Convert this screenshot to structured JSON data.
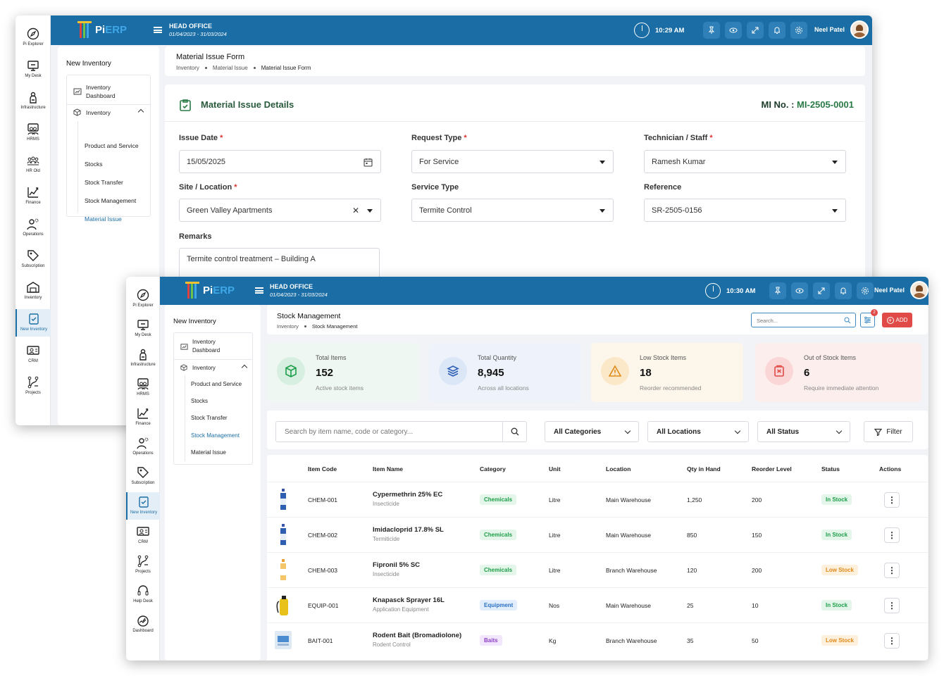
{
  "colors": {
    "brand": "#1b6ea5",
    "accent_green": "#2a7a46",
    "danger": "#e04b47",
    "success": "#1e9e4a",
    "warning": "#e08a1a"
  },
  "window1": {
    "rail": [
      {
        "label": "Pi Explorer",
        "icon": "compass-icon"
      },
      {
        "label": "My Desk",
        "icon": "desk-icon"
      },
      {
        "label": "Infrastructure",
        "icon": "building-icon"
      },
      {
        "label": "HRMS",
        "icon": "people-icon"
      },
      {
        "label": "HR Old",
        "icon": "team-icon"
      },
      {
        "label": "Finance",
        "icon": "chart-icon"
      },
      {
        "label": "Operations",
        "icon": "gear-person-icon"
      },
      {
        "label": "Subscription",
        "icon": "tag-icon"
      },
      {
        "label": "Inventory",
        "icon": "warehouse-icon"
      },
      {
        "label": "New Inventory",
        "icon": "clipboard-icon"
      },
      {
        "label": "CRM",
        "icon": "crm-icon"
      },
      {
        "label": "Projects",
        "icon": "projects-icon"
      }
    ],
    "topbar": {
      "logo_pi": "Pi",
      "logo_erp": "ERP",
      "office": "HEAD OFFICE",
      "fy": "01/04/2023 - 31/03/2024",
      "time": "10:29 AM",
      "user": "Neel Patel"
    },
    "subnav": {
      "heading": "New Inventory",
      "dashboard": "Inventory Dashboard",
      "group": "Inventory",
      "items": [
        "Product and Service",
        "Stocks",
        "Stock Transfer",
        "Stock Management",
        "Material Issue"
      ]
    },
    "page": {
      "title": "Material Issue Form",
      "crumbs": [
        "Inventory",
        "Material Issue",
        "Material Issue Form"
      ]
    },
    "form": {
      "heading": "Material Issue Details",
      "mi_label": "MI No. :",
      "mi_value": "MI-2505-0001",
      "issue_date_label": "Issue Date",
      "issue_date": "15/05/2025",
      "request_type_label": "Request Type",
      "request_type": "For Service",
      "technician_label": "Technician / Staff",
      "technician": "Ramesh Kumar",
      "site_label": "Site / Location",
      "site": "Green Valley Apartments",
      "service_type_label": "Service Type",
      "service_type": "Termite Control",
      "reference_label": "Reference",
      "reference": "SR-2505-0156",
      "remarks_label": "Remarks",
      "remarks": "Termite control treatment – Building A",
      "required_mark": "*"
    }
  },
  "window2": {
    "rail": [
      {
        "label": "Pi Explorer",
        "icon": "compass-icon"
      },
      {
        "label": "My Desk",
        "icon": "desk-icon"
      },
      {
        "label": "Infrastructure",
        "icon": "building-icon"
      },
      {
        "label": "HRMS",
        "icon": "people-icon"
      },
      {
        "label": "Finance",
        "icon": "chart-icon"
      },
      {
        "label": "Operations",
        "icon": "gear-person-icon"
      },
      {
        "label": "Subscription",
        "icon": "tag-icon"
      },
      {
        "label": "New Inventory",
        "icon": "clipboard-icon"
      },
      {
        "label": "CRM",
        "icon": "crm-icon"
      },
      {
        "label": "Projects",
        "icon": "projects-icon"
      },
      {
        "label": "Help Desk",
        "icon": "headset-icon"
      },
      {
        "label": "Dashboard",
        "icon": "dashboard-icon"
      }
    ],
    "topbar": {
      "logo_pi": "Pi",
      "logo_erp": "ERP",
      "office": "HEAD OFFICE",
      "fy": "01/04/2023 - 31/03/2024",
      "time": "10:30 AM",
      "user": "Neel Patel"
    },
    "subnav": {
      "heading": "New Inventory",
      "dashboard": "Inventory Dashboard",
      "group": "Inventory",
      "items": [
        "Product and Service",
        "Stocks",
        "Stock Transfer",
        "Stock Management",
        "Material Issue"
      ]
    },
    "page": {
      "title": "Stock Management",
      "crumbs": [
        "Inventory",
        "Stock Management"
      ],
      "search_placeholder": "Search...",
      "filter_badge": "2",
      "add_label": "ADD"
    },
    "stats": [
      {
        "label": "Total Items",
        "value": "152",
        "sub": "Active stock items"
      },
      {
        "label": "Total Quantity",
        "value": "8,945",
        "sub": "Across all locations"
      },
      {
        "label": "Low Stock Items",
        "value": "18",
        "sub": "Reorder recommended"
      },
      {
        "label": "Out of Stock Items",
        "value": "6",
        "sub": "Require immediate attention"
      }
    ],
    "filters": {
      "search_placeholder": "Search by item name, code or category...",
      "category": "All Categories",
      "location": "All Locations",
      "status": "All Status",
      "filter_label": "Filter"
    },
    "table": {
      "columns": [
        "Item Code",
        "Item Name",
        "Category",
        "Unit",
        "Location",
        "Qty in Hand",
        "Reorder Level",
        "Status",
        "Actions"
      ],
      "rows": [
        {
          "code": "CHEM-001",
          "name": "Cypermethrin 25% EC",
          "type": "Insecticide",
          "category": "Chemicals",
          "unit": "Litre",
          "location": "Main Warehouse",
          "qty": "1,250",
          "reorder": "200",
          "status": "In Stock"
        },
        {
          "code": "CHEM-002",
          "name": "Imidacloprid 17.8% SL",
          "type": "Termiticide",
          "category": "Chemicals",
          "unit": "Litre",
          "location": "Main Warehouse",
          "qty": "850",
          "reorder": "150",
          "status": "In Stock"
        },
        {
          "code": "CHEM-003",
          "name": "Fipronil 5% SC",
          "type": "Insecticide",
          "category": "Chemicals",
          "unit": "Litre",
          "location": "Branch Warehouse",
          "qty": "120",
          "reorder": "200",
          "status": "Low Stock"
        },
        {
          "code": "EQUIP-001",
          "name": "Knapasck Sprayer 16L",
          "type": "Application Equipment",
          "category": "Equipment",
          "unit": "Nos",
          "location": "Main Warehouse",
          "qty": "25",
          "reorder": "10",
          "status": "In Stock"
        },
        {
          "code": "BAIT-001",
          "name": "Rodent Bait (Bromadiolone)",
          "type": "Rodent Control",
          "category": "Baits",
          "unit": "Kg",
          "location": "Branch Warehouse",
          "qty": "35",
          "reorder": "50",
          "status": "Low Stock"
        }
      ]
    }
  }
}
